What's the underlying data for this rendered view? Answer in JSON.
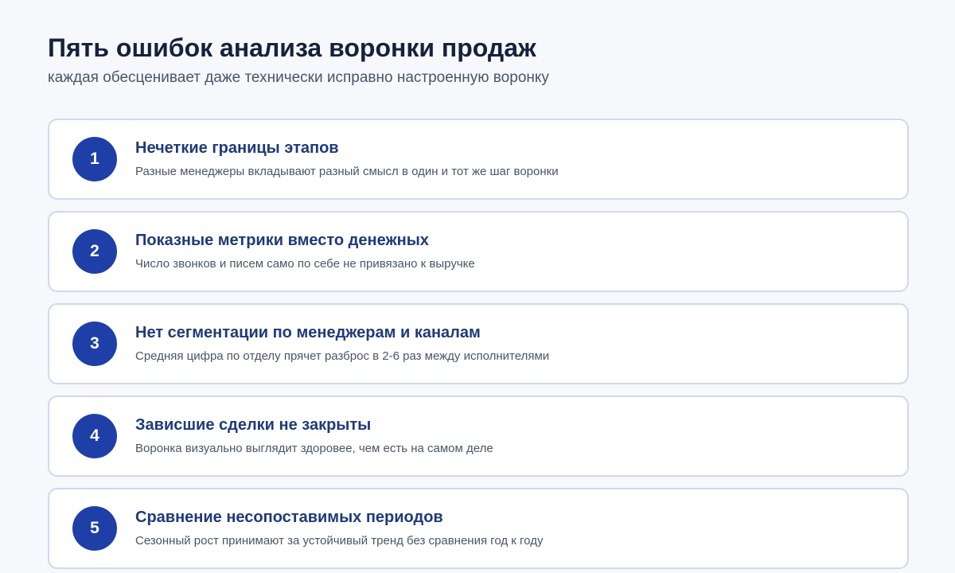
{
  "header": {
    "title": "Пять ошибок анализа воронки продаж",
    "subtitle": "каждая обесценивает даже технически исправно настроенную воронку"
  },
  "items": [
    {
      "number": "1",
      "title": "Нечеткие границы этапов",
      "description": "Разные менеджеры вкладывают разный смысл в один и тот же шаг воронки"
    },
    {
      "number": "2",
      "title": "Показные метрики вместо денежных",
      "description": "Число звонков и писем само по себе не привязано к выручке"
    },
    {
      "number": "3",
      "title": "Нет сегментации по менеджерам и каналам",
      "description": "Средняя цифра по отделу прячет разброс в 2-6 раз между исполнителями"
    },
    {
      "number": "4",
      "title": "Зависшие сделки не закрыты",
      "description": "Воронка визуально выглядит здоровее, чем есть на самом деле"
    },
    {
      "number": "5",
      "title": "Сравнение несопоставимых периодов",
      "description": "Сезонный рост принимают за устойчивый тренд без сравнения год к году"
    }
  ],
  "colors": {
    "background": "#f7f8fc",
    "accent": "#1f3fa8",
    "card_border": "#d0d8f1",
    "title_text": "#16213e",
    "item_title_text": "#1f3a7a",
    "muted_text": "#4a5568"
  }
}
